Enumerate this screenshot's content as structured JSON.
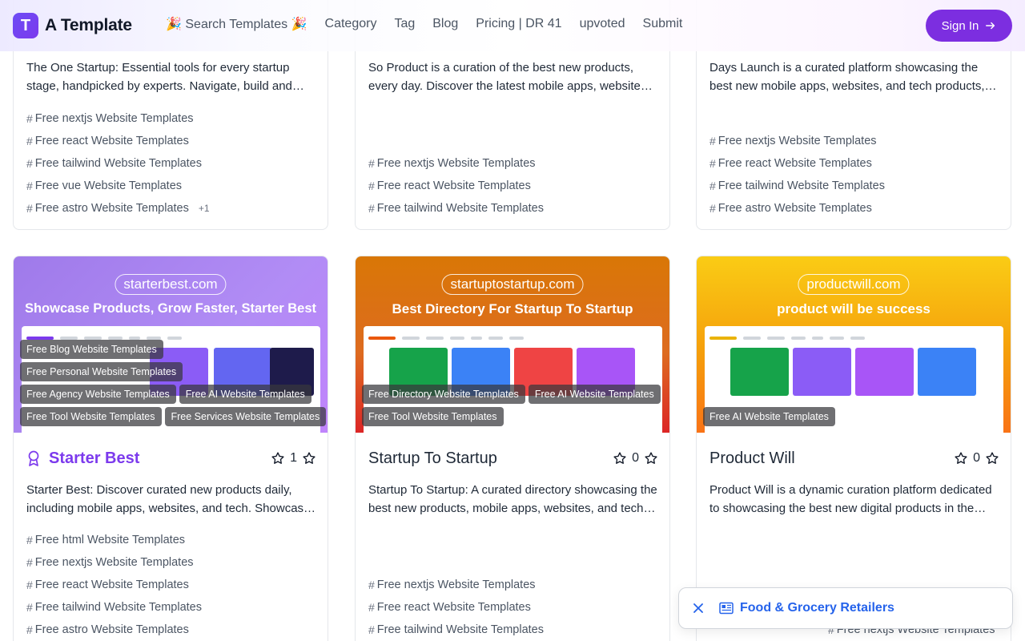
{
  "header": {
    "logo_letter": "T",
    "brand": "A Template",
    "nav": [
      {
        "label": "🎉 Search Templates 🎉",
        "name": "nav-search-templates"
      },
      {
        "label": "Category",
        "name": "nav-category"
      },
      {
        "label": "Tag",
        "name": "nav-tag"
      },
      {
        "label": "Blog",
        "name": "nav-blog"
      },
      {
        "label": "Pricing | DR 41",
        "name": "nav-pricing"
      },
      {
        "label": "upvoted",
        "name": "nav-upvoted"
      },
      {
        "label": "Submit",
        "name": "nav-submit"
      }
    ],
    "signin_label": "Sign In"
  },
  "top_cards": [
    {
      "description": "The One Startup: Essential tools for every startup stage, handpicked by experts. Navigate, build and grow with confidence.",
      "tags": [
        "Free nextjs Website Templates",
        "Free react Website Templates",
        "Free tailwind Website Templates",
        "Free vue Website Templates",
        "Free astro Website Templates"
      ],
      "more": "+1"
    },
    {
      "description": "So Product is a curation of the best new products, every day. Discover the latest mobile apps, websites, and tech.",
      "tags": [
        "Free nextjs Website Templates",
        "Free react Website Templates",
        "Free tailwind Website Templates"
      ]
    },
    {
      "description": "Days Launch is a curated platform showcasing the best new mobile apps, websites, and tech products, every day.",
      "tags": [
        "Free nextjs Website Templates",
        "Free react Website Templates",
        "Free tailwind Website Templates",
        "Free astro Website Templates"
      ]
    }
  ],
  "cards": [
    {
      "thumb_domain": "starterbest.com",
      "thumb_headline": "Showcase Products, Grow Faster, Starter Best",
      "badges": [
        [
          "Free Blog Website Templates"
        ],
        [
          "Free Personal Website Templates"
        ],
        [
          "Free Agency Website Templates",
          "Free AI Website Templates"
        ],
        [
          "Free Tool Website Templates",
          "Free Services Website Templates"
        ]
      ],
      "title": "Starter Best",
      "featured": true,
      "votes": "1",
      "description": "Starter Best: Discover curated new products daily, including mobile apps, websites, and tech. Showcase your product and grow faster.",
      "tags": [
        "Free html Website Templates",
        "Free nextjs Website Templates",
        "Free react Website Templates",
        "Free tailwind Website Templates",
        "Free astro Website Templates"
      ],
      "colors": {
        "from": "#a78bfa",
        "to": "#c084fc"
      }
    },
    {
      "thumb_domain": "startuptostartup.com",
      "thumb_headline": "Best Directory For Startup To Startup",
      "badges": [
        [
          "Free Directory Website Templates",
          "Free AI Website Templates"
        ],
        [
          "Free Tool Website Templates"
        ]
      ],
      "title": "Startup To Startup",
      "featured": false,
      "votes": "0",
      "description": "Startup To Startup: A curated directory showcasing the best new products, mobile apps, websites, and tech for startups.",
      "tags": [
        "Free nextjs Website Templates",
        "Free react Website Templates",
        "Free tailwind Website Templates"
      ],
      "colors": {
        "from": "#d97706",
        "to": "#dc2626"
      }
    },
    {
      "thumb_domain": "productwill.com",
      "thumb_headline": "product will be success",
      "badges": [
        [
          "Free AI Website Templates"
        ]
      ],
      "title": "Product Will",
      "featured": false,
      "votes": "0",
      "description": "Product Will is a dynamic curation platform dedicated to showcasing the best new digital products in the market.",
      "tags": [
        "Free nextjs Website Templates"
      ],
      "colors": {
        "from": "#facc15",
        "to": "#f97316"
      }
    }
  ],
  "toast": {
    "label": "Food & Grocery Retailers"
  }
}
